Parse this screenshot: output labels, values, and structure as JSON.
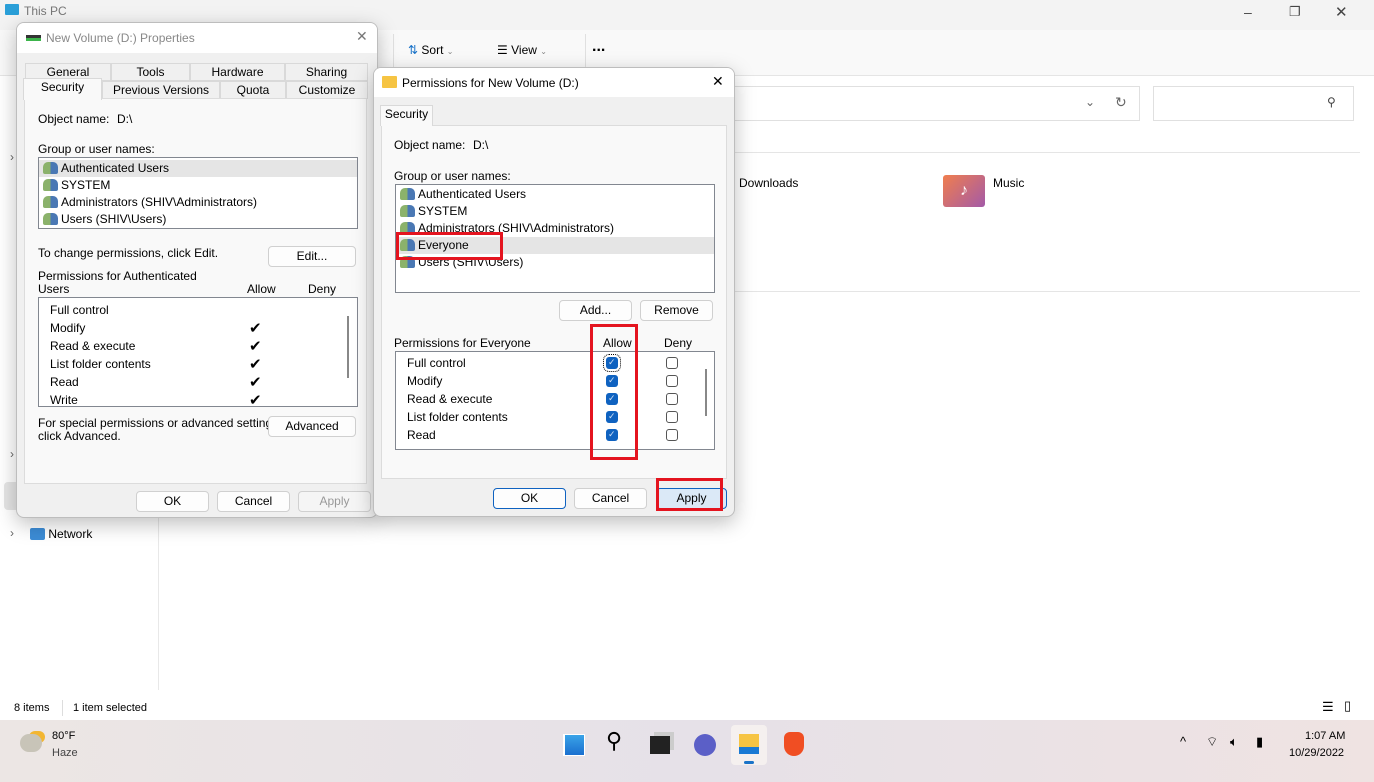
{
  "explorer": {
    "title": "This PC",
    "toolbar": {
      "sort": "Sort",
      "view": "View",
      "more": "..."
    },
    "items": [
      {
        "label": "Downloads"
      },
      {
        "label": "Music"
      }
    ],
    "nav": {
      "network": "Network"
    },
    "status": {
      "count": "8 items",
      "selected": "1 item selected"
    }
  },
  "properties": {
    "title": "New Volume (D:) Properties",
    "tabs_row1": [
      "General",
      "Tools",
      "Hardware",
      "Sharing"
    ],
    "tabs_row2": [
      "Security",
      "Previous Versions",
      "Quota",
      "Customize"
    ],
    "active_tab": "Security",
    "object_label": "Object name:",
    "object_value": "D:\\",
    "group_label": "Group or user names:",
    "users": [
      "Authenticated Users",
      "SYSTEM",
      "Administrators (SHIV\\Administrators)",
      "Users (SHIV\\Users)"
    ],
    "change_text": "To change permissions, click Edit.",
    "edit": "Edit...",
    "perm_label_1": "Permissions for Authenticated",
    "perm_label_2": "Users",
    "allow": "Allow",
    "deny": "Deny",
    "perms": [
      {
        "name": "Full control",
        "allow": false
      },
      {
        "name": "Modify",
        "allow": true
      },
      {
        "name": "Read & execute",
        "allow": true
      },
      {
        "name": "List folder contents",
        "allow": true
      },
      {
        "name": "Read",
        "allow": true
      },
      {
        "name": "Write",
        "allow": true
      }
    ],
    "special_1": "For special permissions or advanced settings,",
    "special_2": "click Advanced.",
    "advanced": "Advanced",
    "ok": "OK",
    "cancel": "Cancel",
    "apply": "Apply"
  },
  "permissions": {
    "title": "Permissions for New Volume (D:)",
    "tab": "Security",
    "object_label": "Object name:",
    "object_value": "D:\\",
    "group_label": "Group or user names:",
    "users": [
      "Authenticated Users",
      "SYSTEM",
      "Administrators (SHIV\\Administrators)",
      "Everyone",
      "Users (SHIV\\Users)"
    ],
    "selected_user": "Everyone",
    "add": "Add...",
    "remove": "Remove",
    "perm_label": "Permissions for Everyone",
    "allow": "Allow",
    "deny": "Deny",
    "perms": [
      {
        "name": "Full control",
        "allow": true,
        "deny": false
      },
      {
        "name": "Modify",
        "allow": true,
        "deny": false
      },
      {
        "name": "Read & execute",
        "allow": true,
        "deny": false
      },
      {
        "name": "List folder contents",
        "allow": true,
        "deny": false
      },
      {
        "name": "Read",
        "allow": true,
        "deny": false
      }
    ],
    "ok": "OK",
    "cancel": "Cancel",
    "apply": "Apply"
  },
  "taskbar": {
    "temp": "80°F",
    "weather": "Haze",
    "time": "1:07 AM",
    "date": "10/29/2022"
  },
  "colors": {
    "accent": "#0f62c0",
    "highlight": "#e4141f"
  }
}
